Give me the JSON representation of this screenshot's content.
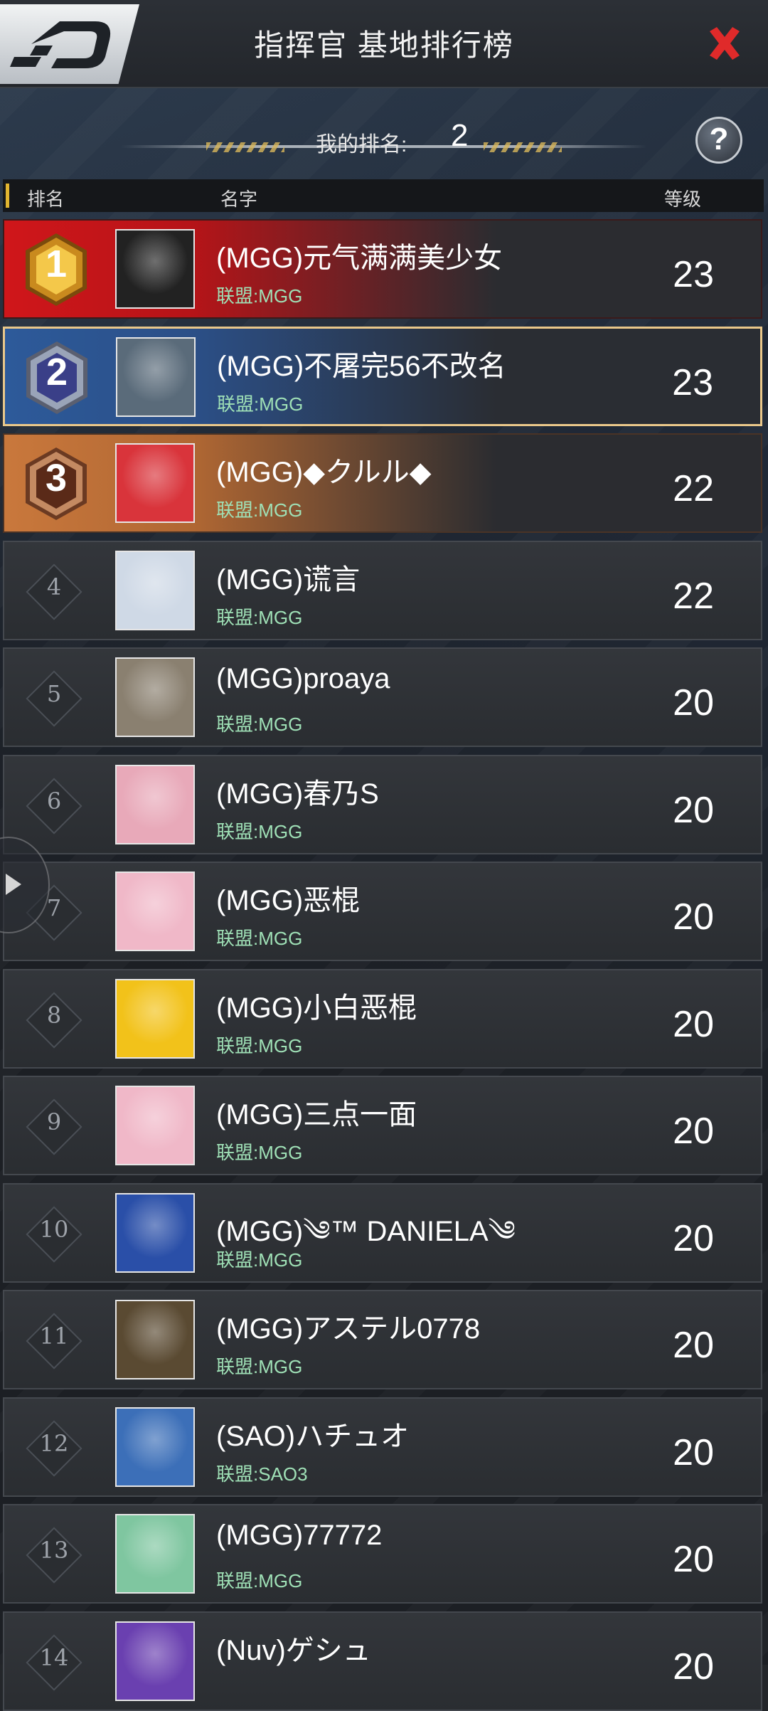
{
  "header": {
    "title": "指挥官 基地排行榜"
  },
  "my_rank": {
    "label": "我的排名:",
    "value": "2"
  },
  "help": {
    "label": "?"
  },
  "columns": {
    "rank": "排名",
    "name": "名字",
    "level": "等级"
  },
  "rows": [
    {
      "rank": "1",
      "name": "(MGG)元气满满美少女",
      "alliance": "联盟:MGG",
      "level": "23",
      "avatar_icon": "eagle-avatar",
      "tier": "gold",
      "avatar_bg": "#222222"
    },
    {
      "rank": "2",
      "name": "(MGG)不屠完56不改名",
      "alliance": "联盟:MGG",
      "level": "23",
      "avatar_icon": "girl-photo-avatar",
      "tier": "silver",
      "avatar_bg": "#5a6b7a"
    },
    {
      "rank": "3",
      "name": "(MGG)◆クルル◆",
      "alliance": "联盟:MGG",
      "level": "22",
      "avatar_icon": "pink-hair-anime-avatar",
      "tier": "bronze",
      "avatar_bg": "#d9343b"
    },
    {
      "rank": "4",
      "name": "(MGG)谎言",
      "alliance": "联盟:MGG",
      "level": "22",
      "avatar_icon": "white-hair-anime-avatar",
      "tier": "normal",
      "avatar_bg": "#cfd9e6"
    },
    {
      "rank": "5",
      "name": "(MGG)proaya",
      "alliance": "联盟:MGG",
      "level": "20",
      "avatar_icon": "cartoon-bird-avatar",
      "tier": "normal",
      "avatar_bg": "#8a8070"
    },
    {
      "rank": "6",
      "name": "(MGG)春乃S",
      "alliance": "联盟:MGG",
      "level": "20",
      "avatar_icon": "teddy-bear-avatar",
      "tier": "normal",
      "avatar_bg": "#e8a9b9"
    },
    {
      "rank": "7",
      "name": "(MGG)恶棍",
      "alliance": "联盟:MGG",
      "level": "20",
      "avatar_icon": "anime-girl-cap-avatar",
      "tier": "normal",
      "avatar_bg": "#f0b8c8"
    },
    {
      "rank": "8",
      "name": "(MGG)小白恶棍",
      "alliance": "联盟:MGG",
      "level": "20",
      "avatar_icon": "brown-bear-avatar",
      "tier": "normal",
      "avatar_bg": "#f2c21a"
    },
    {
      "rank": "9",
      "name": "(MGG)三点一面",
      "alliance": "联盟:MGG",
      "level": "20",
      "avatar_icon": "anime-girl-cap-avatar",
      "tier": "normal",
      "avatar_bg": "#f0b8c8"
    },
    {
      "rank": "10",
      "name": "(MGG)༄™ DANIELA༄",
      "alliance": "联盟:MGG",
      "level": "20",
      "avatar_icon": "woman-photo-avatar",
      "tier": "normal",
      "avatar_bg": "#2a4fa8"
    },
    {
      "rank": "11",
      "name": "(MGG)アステル0778",
      "alliance": "联盟:MGG",
      "level": "20",
      "avatar_icon": "emblem-avatar",
      "tier": "normal",
      "avatar_bg": "#5a4a32"
    },
    {
      "rank": "12",
      "name": "(SAO)ハチュオ",
      "alliance": "联盟:SAO3",
      "level": "20",
      "avatar_icon": "brown-hair-anime-avatar",
      "tier": "normal",
      "avatar_bg": "#3c6fb8"
    },
    {
      "rank": "13",
      "name": "(MGG)77772",
      "alliance": "联盟:MGG",
      "level": "20",
      "avatar_icon": "squirtle-avatar",
      "tier": "normal",
      "avatar_bg": "#7fc6a0"
    },
    {
      "rank": "14",
      "name": "(Nuv)ゲシュ",
      "alliance": "",
      "level": "20",
      "avatar_icon": "purple-abstract-avatar",
      "tier": "normal",
      "avatar_bg": "#6a40b0"
    }
  ]
}
